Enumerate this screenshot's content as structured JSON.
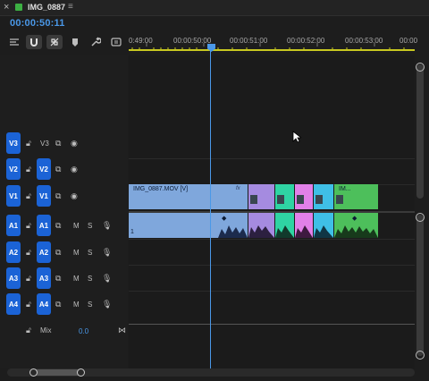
{
  "tab": {
    "title": "IMG_0887",
    "close": "×",
    "menu": "≡"
  },
  "timecode": "00:00:50:11",
  "ruler": {
    "labels": [
      "0:49:00",
      "00:00:50:00",
      "00:00:51:00",
      "00:00:52:00",
      "00:00:53:00",
      "00:00"
    ]
  },
  "video_tracks": [
    {
      "id": "V3",
      "source": "",
      "label": "V3"
    },
    {
      "id": "V2",
      "source": "V2",
      "label": "V2"
    },
    {
      "id": "V1",
      "source": "V1",
      "label": "V1"
    }
  ],
  "audio_tracks": [
    {
      "id": "A1",
      "source": "A1",
      "m": "M",
      "s": "S"
    },
    {
      "id": "A2",
      "source": "A2",
      "m": "M",
      "s": "S"
    },
    {
      "id": "A3",
      "source": "A3",
      "m": "M",
      "s": "S"
    },
    {
      "id": "A4",
      "source": "A4",
      "m": "M",
      "s": "S"
    }
  ],
  "mix": {
    "label": "Mix",
    "value": "0.0"
  },
  "clips": {
    "video_main": "IMG_0887.MOV [V]",
    "video_last": "IM...",
    "audio_channel": "1",
    "fx": "fx"
  },
  "colors": {
    "accent": "#4a98e8",
    "track_button": "#1b63d6",
    "clip_blue": "#7fa7dc",
    "clip_purple": "#a58be0",
    "clip_teal": "#2fd4a3",
    "clip_pink": "#e280e8",
    "clip_cyan": "#3fbfe6",
    "clip_green": "#4dbf5b"
  }
}
